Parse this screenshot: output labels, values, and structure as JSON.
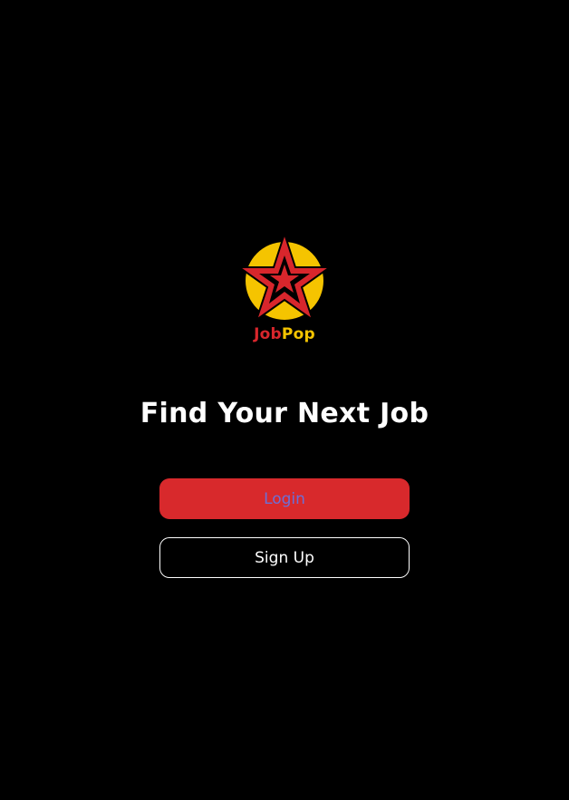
{
  "brand": {
    "logo_icon": "star-badge-icon",
    "word_part1": "Job",
    "word_part2": "Pop",
    "color_red": "#d8262c",
    "color_yellow": "#f5c400"
  },
  "headline": "Find Your Next Job",
  "actions": {
    "login_label": "Login",
    "signup_label": "Sign Up",
    "login_bg": "#d8292c",
    "login_text_color": "#6b6fd6",
    "signup_border": "#ffffff"
  },
  "background": "#000000"
}
